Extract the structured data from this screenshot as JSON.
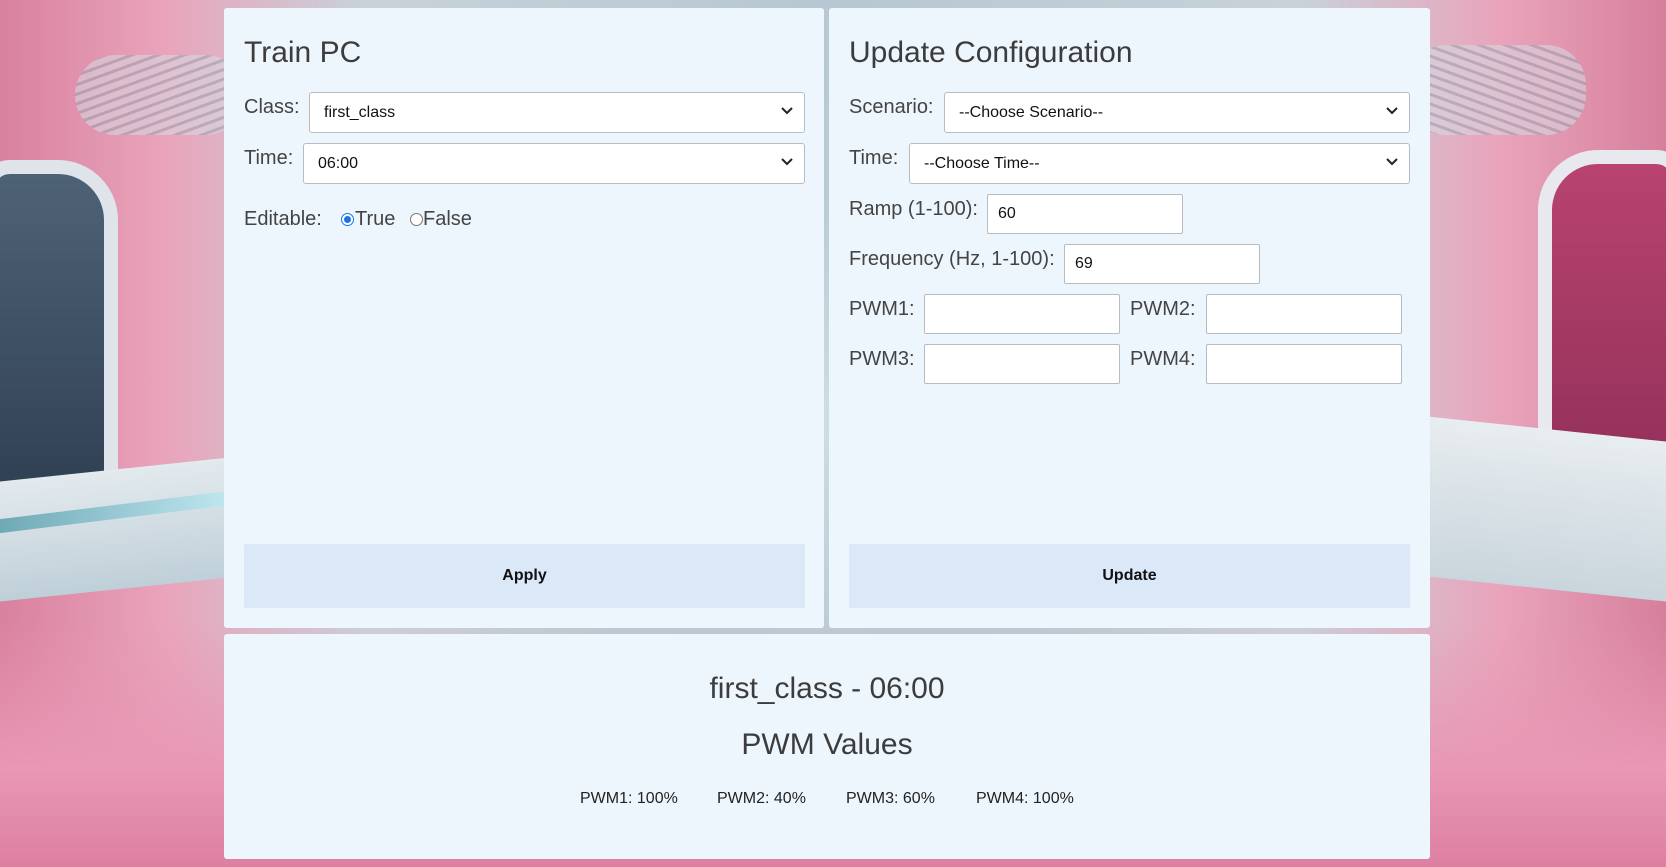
{
  "train_pc": {
    "title": "Train PC",
    "class_label": "Class:",
    "class_value": "first_class",
    "time_label": "Time:",
    "time_value": "06:00",
    "editable_label": "Editable:",
    "editable_options": [
      "True",
      "False"
    ],
    "editable_selected": "True",
    "apply_label": "Apply"
  },
  "update_config": {
    "title": "Update Configuration",
    "scenario_label": "Scenario:",
    "scenario_value": "--Choose Scenario--",
    "time_label": "Time:",
    "time_value": "--Choose Time--",
    "ramp_label": "Ramp (1-100):",
    "ramp_value": "60",
    "frequency_label": "Frequency (Hz, 1-100):",
    "frequency_value": "69",
    "pwm1_label": "PWM1:",
    "pwm2_label": "PWM2:",
    "pwm3_label": "PWM3:",
    "pwm4_label": "PWM4:",
    "pwm1_value": "",
    "pwm2_value": "",
    "pwm3_value": "",
    "pwm4_value": "",
    "update_label": "Update"
  },
  "summary": {
    "heading": "first_class - 06:00",
    "subheading": "PWM Values",
    "pwm_values": [
      "PWM1: 100%",
      "PWM2: 40%",
      "PWM3: 60%",
      "PWM4: 100%"
    ]
  },
  "colors": {
    "panel_bg": "#eef6fd",
    "button_bg": "#dae8f8",
    "radio_accent": "#1a73e8"
  }
}
